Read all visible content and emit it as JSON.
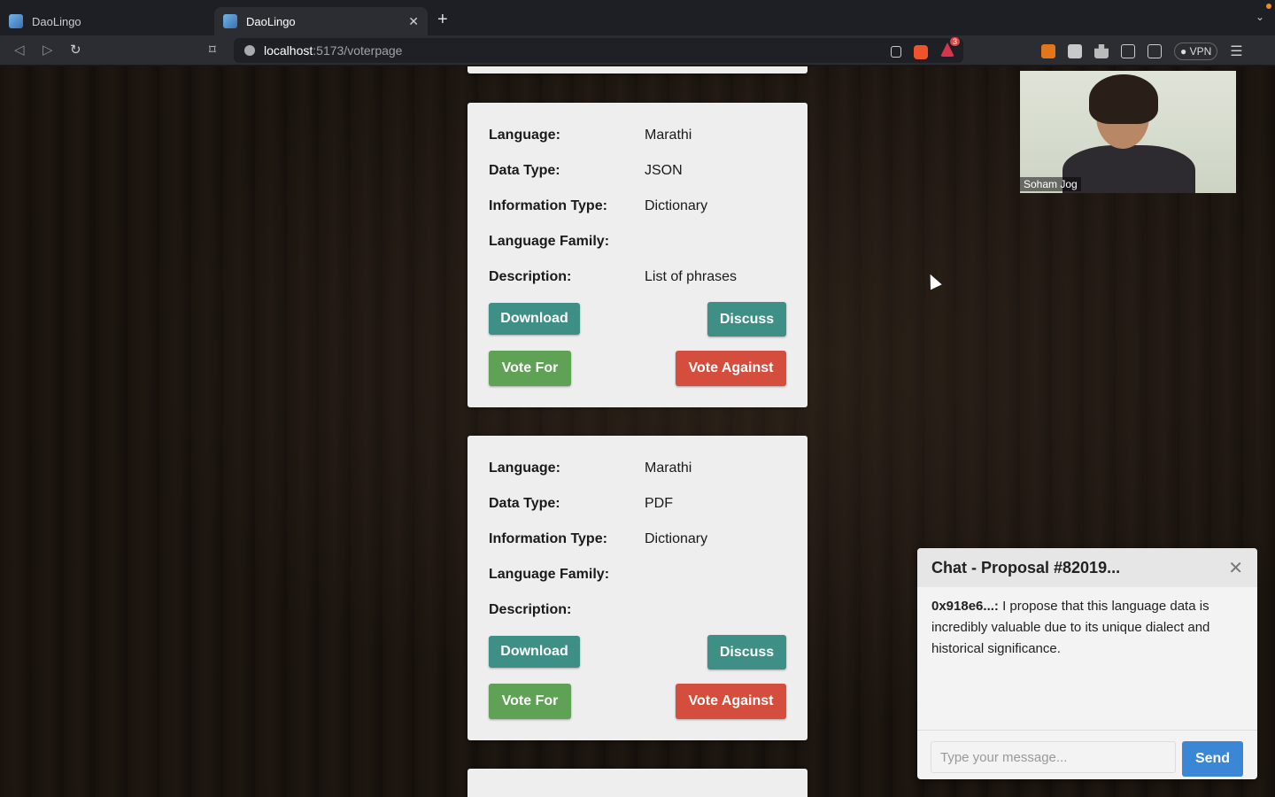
{
  "browser": {
    "tabs": [
      {
        "title": "DaoLingo",
        "active": false
      },
      {
        "title": "DaoLingo",
        "active": true
      }
    ],
    "url_host": "localhost",
    "url_path": ":5173/voterpage",
    "vpn_label": "VPN",
    "notification_count": "3"
  },
  "cards": [
    {
      "fields": [
        {
          "label": "Language:",
          "value": "Marathi"
        },
        {
          "label": "Data Type:",
          "value": "JSON"
        },
        {
          "label": "Information Type:",
          "value": "Dictionary"
        },
        {
          "label": "Language Family:",
          "value": ""
        },
        {
          "label": "Description:",
          "value": "List of phrases"
        }
      ],
      "download_label": "Download",
      "discuss_label": "Discuss",
      "vote_for_label": "Vote For",
      "vote_against_label": "Vote Against"
    },
    {
      "fields": [
        {
          "label": "Language:",
          "value": "Marathi"
        },
        {
          "label": "Data Type:",
          "value": "PDF"
        },
        {
          "label": "Information Type:",
          "value": "Dictionary"
        },
        {
          "label": "Language Family:",
          "value": ""
        },
        {
          "label": "Description:",
          "value": ""
        }
      ],
      "download_label": "Download",
      "discuss_label": "Discuss",
      "vote_for_label": "Vote For",
      "vote_against_label": "Vote Against"
    }
  ],
  "video": {
    "participant_name": "Soham Jog"
  },
  "chat": {
    "title": "Chat - Proposal #82019...",
    "close_symbol": "✕",
    "messages": [
      {
        "sender": "0x918e6...:",
        "text": " I propose that this language data is incredibly valuable due to its unique dialect and historical significance."
      }
    ],
    "input_placeholder": "Type your message...",
    "send_label": "Send"
  },
  "colors": {
    "download": "#3e8f86",
    "discuss": "#3e8f86",
    "vote_for": "#5fa256",
    "vote_against": "#d44d3d",
    "send": "#3c86d6"
  }
}
